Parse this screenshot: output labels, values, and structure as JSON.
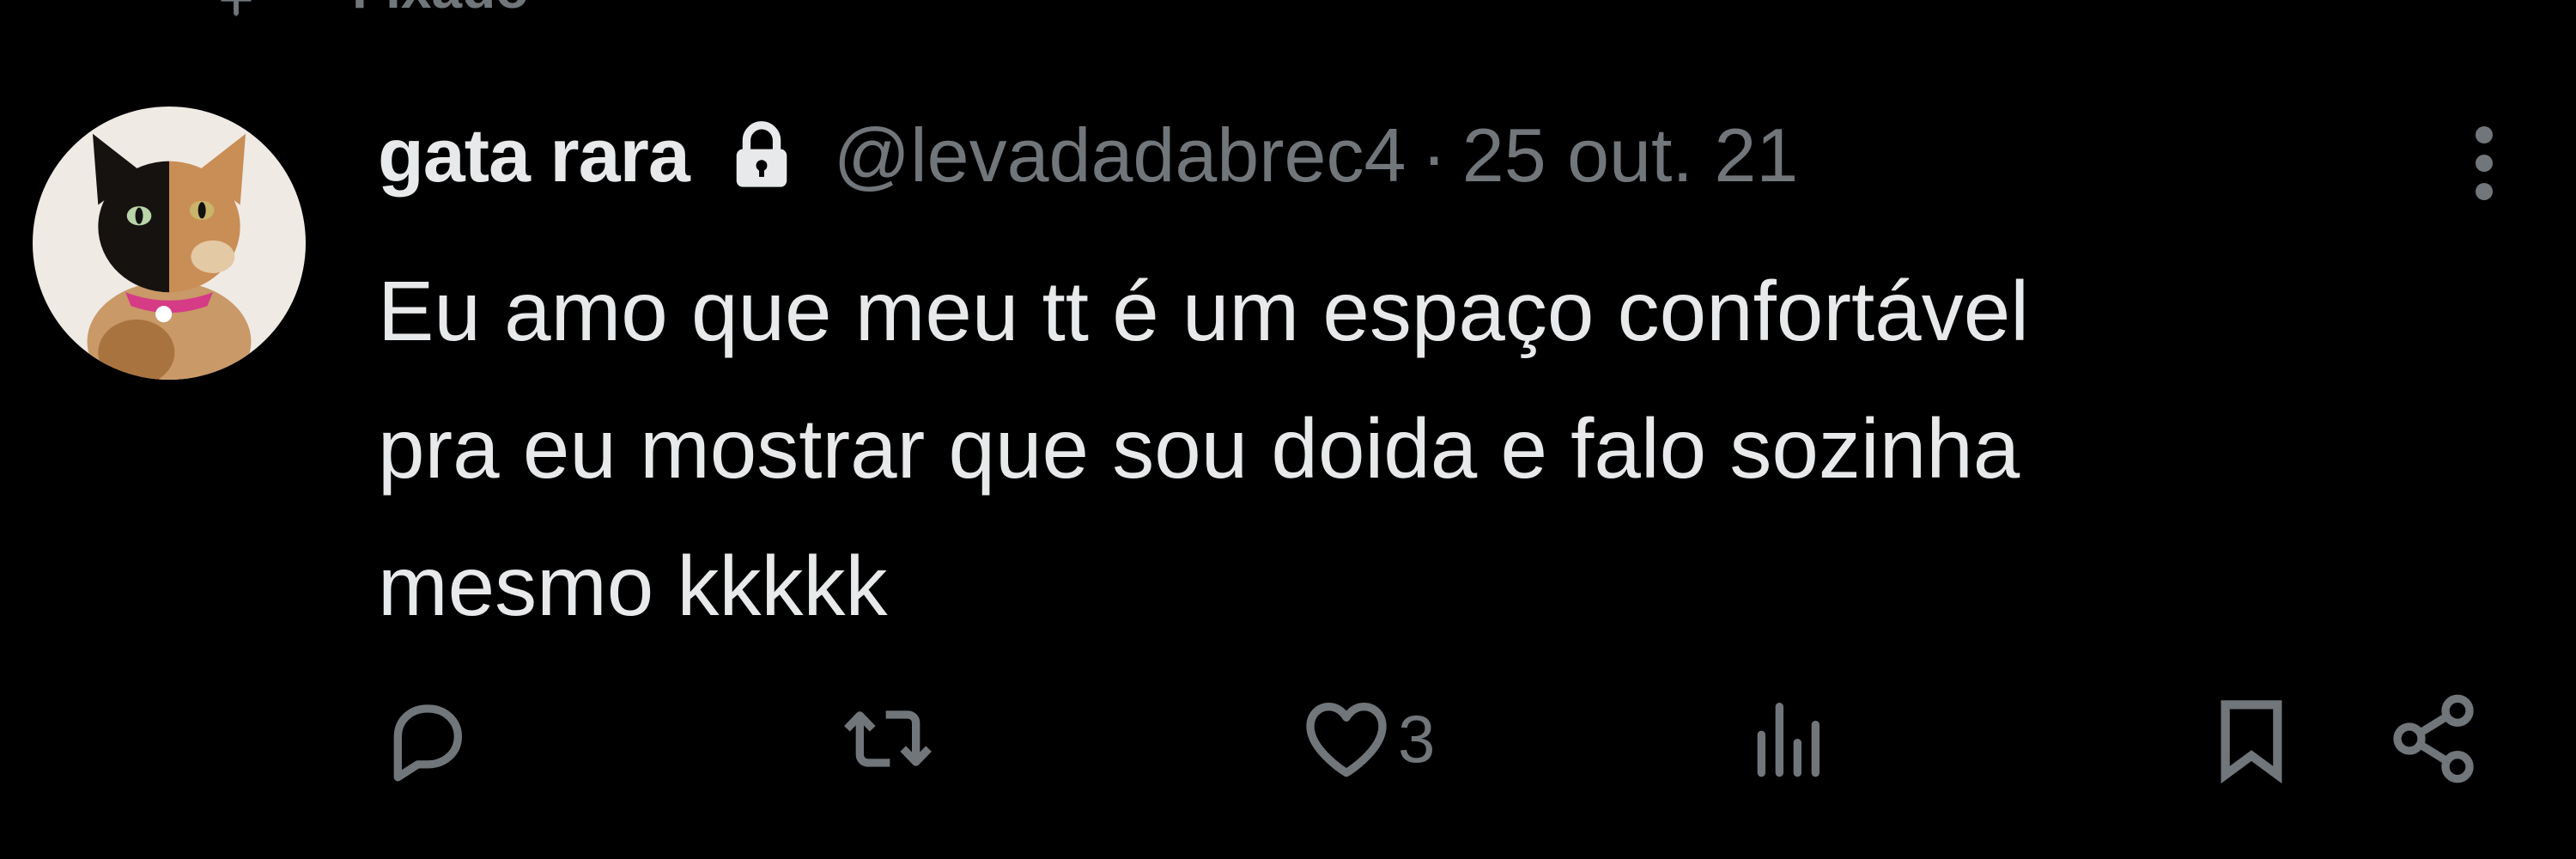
{
  "pinned": {
    "label": "Fixado",
    "icon": "pin-icon"
  },
  "tweet": {
    "author": {
      "display_name": "gata rara",
      "handle": "@levadadabrec4",
      "protected_icon": "lock-icon",
      "avatar_icon": "cat-avatar"
    },
    "separator": "·",
    "timestamp": "25 out. 21",
    "text_lines": [
      "Eu amo que meu tt é um espaço confortável",
      "pra eu mostrar que sou doida e falo sozinha",
      "mesmo kkkkk"
    ],
    "more_icon": "more-vertical-icon"
  },
  "actions": {
    "reply": {
      "icon": "reply-icon",
      "count": ""
    },
    "retweet": {
      "icon": "retweet-icon",
      "count": ""
    },
    "like": {
      "icon": "heart-icon",
      "count": "3"
    },
    "views": {
      "icon": "views-icon",
      "count": ""
    },
    "bookmark": {
      "icon": "bookmark-icon"
    },
    "share": {
      "icon": "share-icon"
    }
  },
  "colors": {
    "background": "#000000",
    "primary_text": "#e7e9ea",
    "secondary_text": "#71767b"
  }
}
